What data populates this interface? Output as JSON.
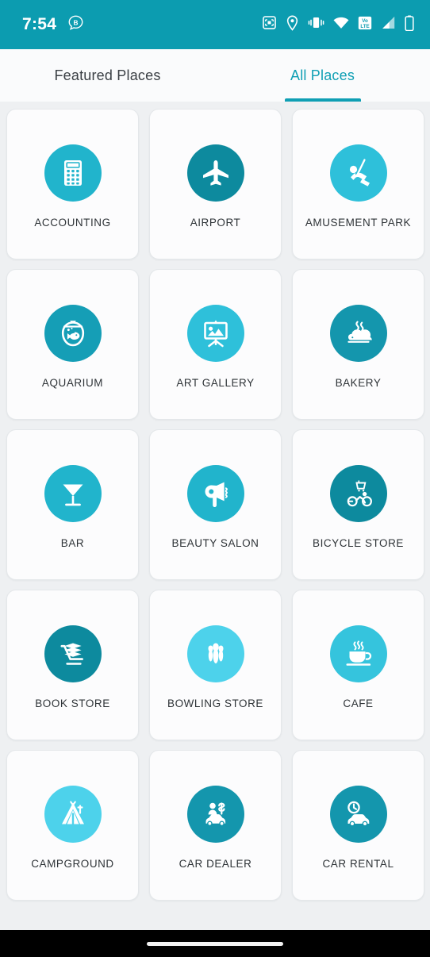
{
  "status_bar": {
    "time": "7:54",
    "background_color": "#0c9cb0",
    "left_icons": [
      {
        "name": "bubble-b-icon",
        "label": "B"
      }
    ],
    "right_icons": [
      {
        "name": "screen-record-icon"
      },
      {
        "name": "location-pin-icon"
      },
      {
        "name": "vibrate-icon"
      },
      {
        "name": "wifi-icon"
      },
      {
        "name": "volte-icon",
        "label": "Vo LTE"
      },
      {
        "name": "signal-bars-icon"
      },
      {
        "name": "battery-icon"
      }
    ]
  },
  "tabs": [
    {
      "label": "Featured Places",
      "active": false
    },
    {
      "label": "All Places",
      "active": true
    }
  ],
  "theme": {
    "accent": "#0f9fb4",
    "status_bar": "#0c9cb0",
    "page_background": "#eef0f2",
    "card_background": "#fcfcfd",
    "card_border": "#e4e7ea",
    "label_color": "#2e3337",
    "tab_inactive_color": "#3a3f44",
    "nav_bar": "#000000"
  },
  "grid": {
    "columns": 3,
    "items": [
      {
        "label": "ACCOUNTING",
        "icon": "calculator-icon",
        "circle_color": "#21b4cc"
      },
      {
        "label": "AIRPORT",
        "icon": "airplane-icon",
        "circle_color": "#0d8a9e"
      },
      {
        "label": "AMUSEMENT PARK",
        "icon": "swing-ride-icon",
        "circle_color": "#2ec0da"
      },
      {
        "label": "AQUARIUM",
        "icon": "fishbowl-icon",
        "circle_color": "#159eb6"
      },
      {
        "label": "ART GALLERY",
        "icon": "easel-picture-icon",
        "circle_color": "#2ec0da"
      },
      {
        "label": "BAKERY",
        "icon": "bread-loaf-icon",
        "circle_color": "#1496ad"
      },
      {
        "label": "BAR",
        "icon": "martini-glass-icon",
        "circle_color": "#21b4cc"
      },
      {
        "label": "BEAUTY SALON",
        "icon": "hairdryer-icon",
        "circle_color": "#21b4cc"
      },
      {
        "label": "BICYCLE STORE",
        "icon": "cyclist-cart-icon",
        "circle_color": "#0d8a9e"
      },
      {
        "label": "BOOK STORE",
        "icon": "books-cart-icon",
        "circle_color": "#0d8a9e"
      },
      {
        "label": "BOWLING STORE",
        "icon": "bowling-pins-icon",
        "circle_color": "#4dd2eb"
      },
      {
        "label": "CAFE",
        "icon": "coffee-cup-icon",
        "circle_color": "#35c4dd"
      },
      {
        "label": "CAMPGROUND",
        "icon": "tent-icon",
        "circle_color": "#4dd2eb"
      },
      {
        "label": "CAR DEALER",
        "icon": "car-salesman-icon",
        "circle_color": "#1496ad"
      },
      {
        "label": "CAR RENTAL",
        "icon": "car-clock-icon",
        "circle_color": "#1496ad"
      }
    ]
  },
  "nav_bar": {
    "home_indicator": "home-indicator"
  }
}
